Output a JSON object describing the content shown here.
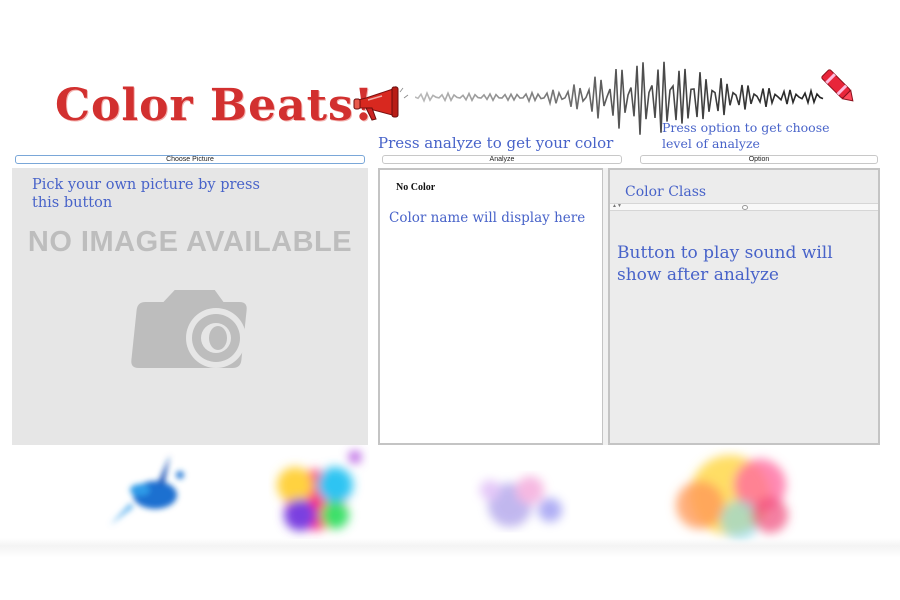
{
  "app_title": "Color Beats!",
  "icons": {
    "megaphone": "megaphone-icon",
    "sound_wave": "sound-wave-icon",
    "crayon": "crayon-icon",
    "camera": "camera-icon"
  },
  "hints": {
    "analyze": "Press analyze to get your color",
    "option_line1": "Press option to get choose",
    "option_line2": "level of analyze"
  },
  "buttons": {
    "choose_picture": "Choose Picture",
    "analyze": "Analyze",
    "option": "Option"
  },
  "picture_panel": {
    "instruction": "Pick your own picture by press this button",
    "placeholder": "NO IMAGE AVAILABLE"
  },
  "color_panel": {
    "color_name": "No Color",
    "hint": "Color name will display here"
  },
  "class_panel": {
    "label": "Color Class",
    "slider_arrows": "▲▼",
    "sound_hint": "Button to play sound will show after analyze"
  },
  "colors": {
    "title_red": "#d2302f",
    "hint_blue": "#4863c9",
    "panel_gray": "#e6e6e6"
  }
}
